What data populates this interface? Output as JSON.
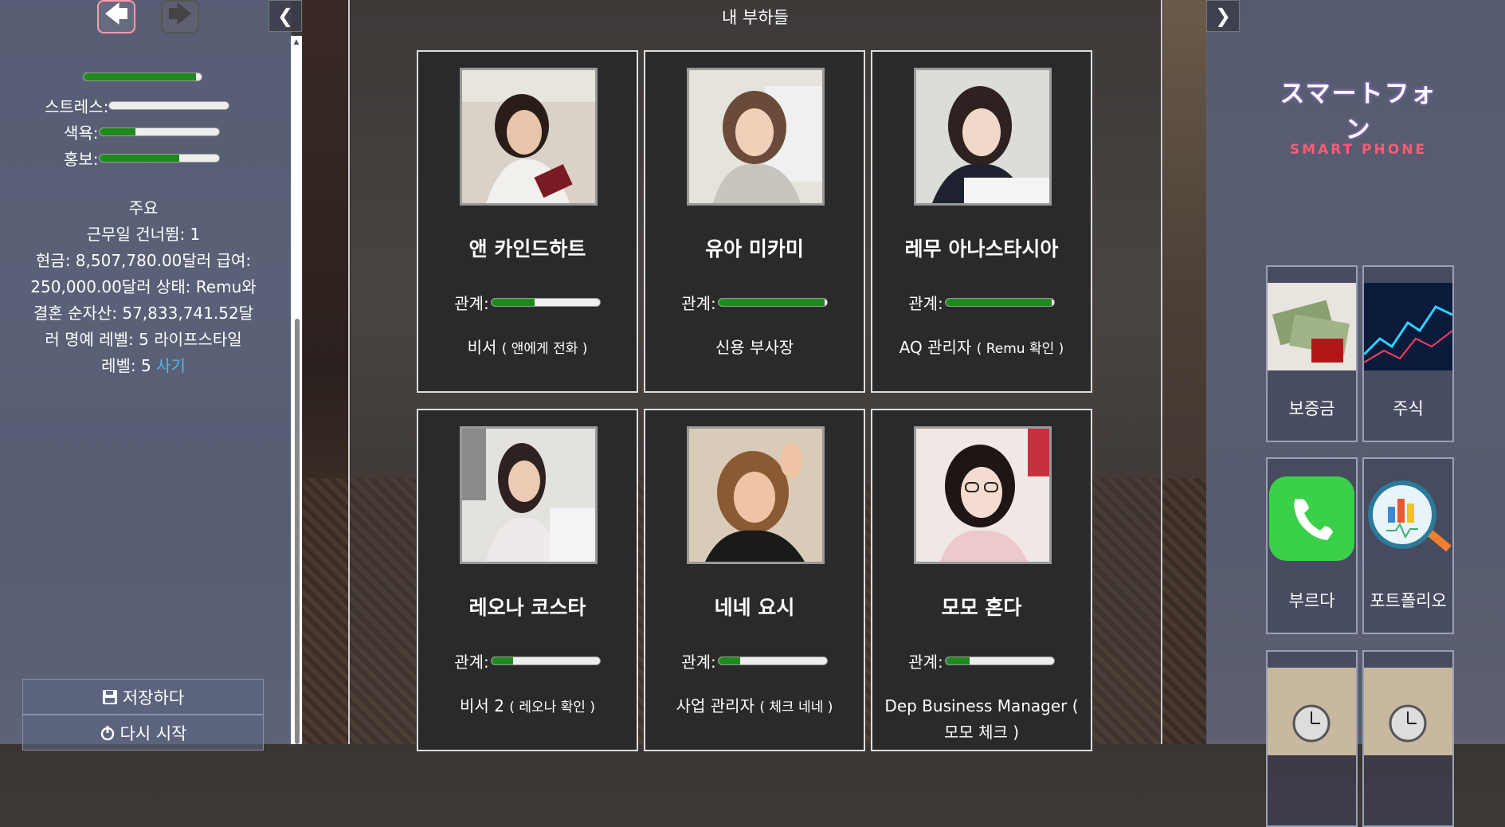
{
  "sidebar": {
    "back_arrow": "🡄",
    "forward_arrow": "🡆",
    "toggle_arrow": "❮",
    "energy_fraction": 0.95,
    "stats": [
      {
        "label": "스트레스:",
        "value": 0.0
      },
      {
        "label": "색욕:",
        "value": 0.3
      },
      {
        "label": "홍보:",
        "value": 0.67
      }
    ],
    "info": {
      "heading": "주요",
      "line1": "근무일 건너뜀: 1",
      "line2": "현금: 8,507,780.00달러 급여:",
      "line3": "250,000.00달러 상태: Remu와",
      "line4": "결혼 순자산: 57,833,741.52달",
      "line5": "러 명예 레벨: 5 라이프스타일",
      "line6": "레벨: 5 ",
      "buy_link": "사기"
    },
    "save_label": "저장하다",
    "restart_label": "다시 시작"
  },
  "main": {
    "title": "내 부하들",
    "relation_label": "관계:",
    "cards": [
      {
        "name": "앤 카인드하트",
        "relation": 0.4,
        "role": "비서",
        "role_sub": "( 앤에게 전화 )"
      },
      {
        "name": "유아 미카미",
        "relation": 0.98,
        "role": "신용 부사장",
        "role_sub": ""
      },
      {
        "name": "레무 아나스타시아",
        "relation": 0.98,
        "role": "AQ 관리자",
        "role_sub": "( Remu 확인 )"
      },
      {
        "name": "레오나 코스타",
        "relation": 0.2,
        "role": "비서 2",
        "role_sub": "( 레오나 확인 )"
      },
      {
        "name": "네네 요시",
        "relation": 0.2,
        "role": "사업 관리자",
        "role_sub": "( 체크 네네 )"
      },
      {
        "name": "모모 혼다",
        "relation": 0.22,
        "role": "Dep Business Manager ( 모모 체크 )",
        "role_sub": ""
      }
    ]
  },
  "right": {
    "toggle_arrow": "❯",
    "logo_jp": "スマートフォン",
    "logo_en": "SMART PHONE",
    "apps": [
      {
        "label": "보증금",
        "icon": "money-icon"
      },
      {
        "label": "주식",
        "icon": "stock-chart-icon"
      },
      {
        "label": "부르다",
        "icon": "phone-icon"
      },
      {
        "label": "포트폴리오",
        "icon": "portfolio-icon"
      },
      {
        "label": "",
        "icon": "clock-icon"
      },
      {
        "label": "",
        "icon": "clock-icon"
      }
    ]
  },
  "colors": {
    "bar_fill": "#1e8a1e",
    "link": "#4fb6e8",
    "logo_accent": "#ff5a78"
  }
}
